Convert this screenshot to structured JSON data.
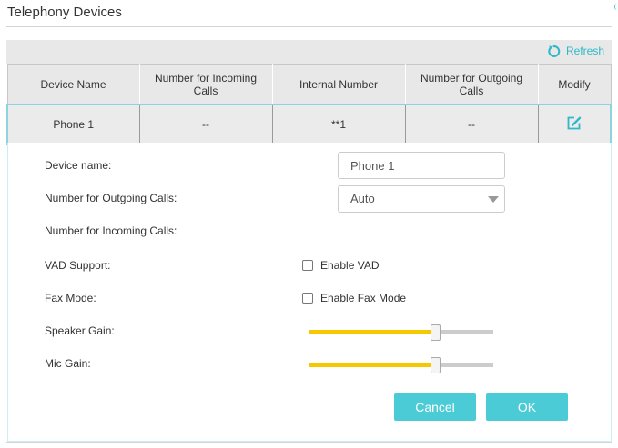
{
  "page": {
    "title": "Telephony Devices"
  },
  "toolbar": {
    "refresh_label": "Refresh",
    "refresh_icon": "refresh-icon",
    "accent_color": "#2eb8c8"
  },
  "table": {
    "headers": [
      "Device Name",
      "Number for Incoming Calls",
      "Internal Number",
      "Number for Outgoing Calls",
      "Modify"
    ],
    "rows": [
      {
        "device_name": "Phone 1",
        "incoming": "--",
        "internal": "**1",
        "outgoing": "--",
        "modify_icon": "edit-icon"
      }
    ]
  },
  "form": {
    "device_name_label": "Device name:",
    "device_name_value": "Phone 1",
    "outgoing_label": "Number for Outgoing Calls:",
    "outgoing_value": "Auto",
    "incoming_label": "Number for Incoming Calls:",
    "vad_label": "VAD Support:",
    "vad_option": "Enable VAD",
    "vad_checked": false,
    "fax_label": "Fax Mode:",
    "fax_option": "Enable Fax Mode",
    "fax_checked": false,
    "speaker_gain_label": "Speaker Gain:",
    "speaker_gain_level": 0.69,
    "mic_gain_label": "Mic Gain:",
    "mic_gain_level": 0.69,
    "slider_fill_color": "#f5c800",
    "cancel_label": "Cancel",
    "ok_label": "OK",
    "button_color": "#4acbd6"
  }
}
